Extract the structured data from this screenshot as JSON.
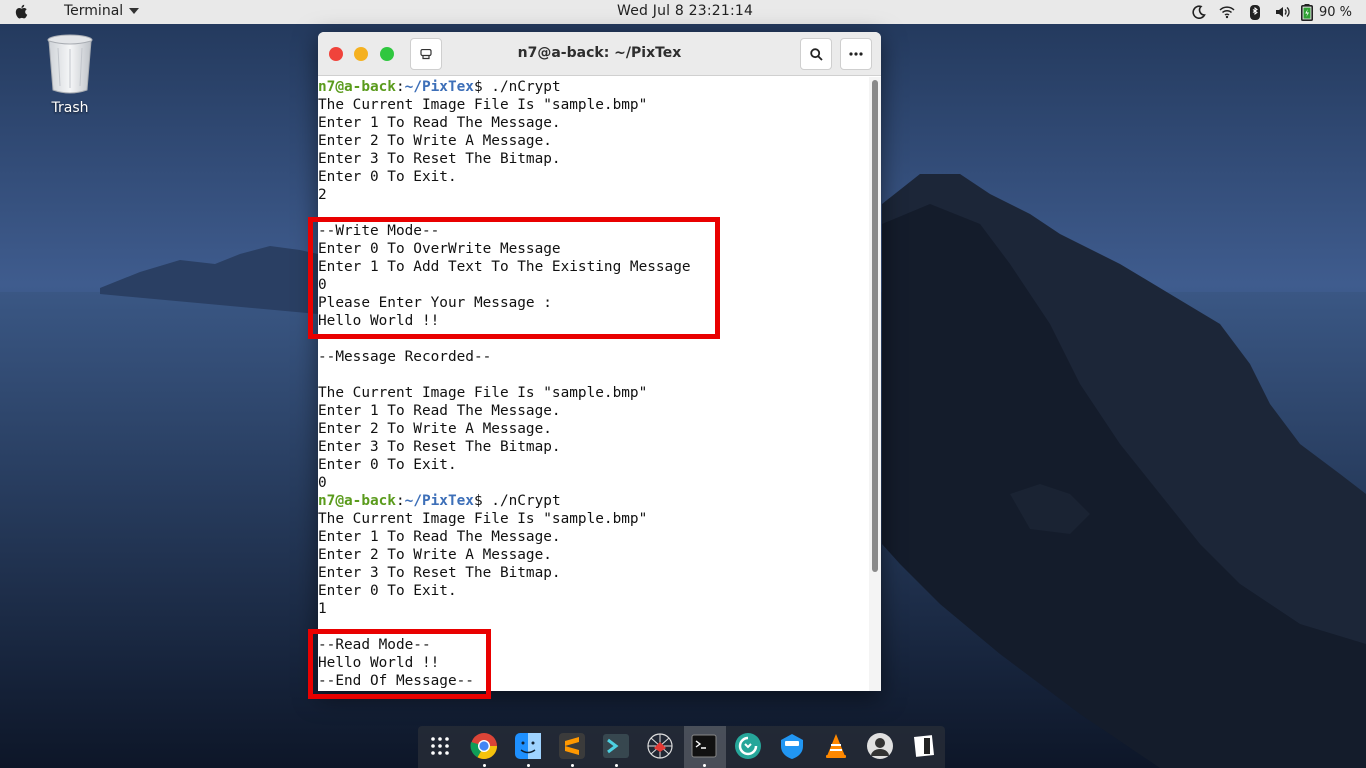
{
  "topbar": {
    "app_name": "Terminal",
    "clock": "Wed Jul 8  23:21:14",
    "battery": "90 %"
  },
  "desktop": {
    "trash_label": "Trash"
  },
  "window": {
    "title": "n7@a-back: ~/PixTex"
  },
  "terminal": {
    "prompt_user": "n7@a-back",
    "prompt_path": "~/PixTex",
    "command": "$ ./nCrypt",
    "lines": [
      "The Current Image File Is \"sample.bmp\"",
      "Enter 1 To Read The Message.",
      "Enter 2 To Write A Message.",
      "Enter 3 To Reset The Bitmap.",
      "Enter 0 To Exit.",
      "2",
      "",
      "--Write Mode--",
      "Enter 0 To OverWrite Message",
      "Enter 1 To Add Text To The Existing Message",
      "0",
      "Please Enter Your Message :",
      "Hello World !!",
      "",
      "--Message Recorded--",
      "",
      "The Current Image File Is \"sample.bmp\"",
      "Enter 1 To Read The Message.",
      "Enter 2 To Write A Message.",
      "Enter 3 To Reset The Bitmap.",
      "Enter 0 To Exit.",
      "0",
      "PROMPT",
      "The Current Image File Is \"sample.bmp\"",
      "Enter 1 To Read The Message.",
      "Enter 2 To Write A Message.",
      "Enter 3 To Reset The Bitmap.",
      "Enter 0 To Exit.",
      "1",
      "",
      "--Read Mode--",
      "Hello World !!",
      "--End Of Message--"
    ]
  },
  "colors": {
    "prompt_user": "#5a9b1c",
    "prompt_path": "#3d6fb8",
    "highlight": "#e90000"
  },
  "dock": {
    "items": [
      "grid-icon",
      "chrome-icon",
      "finder-icon",
      "sublime-icon",
      "terminal-alt-icon",
      "network-icon",
      "terminal-icon",
      "update-icon",
      "vpn-icon",
      "vlc-icon",
      "avatar-icon",
      "notes-icon"
    ]
  }
}
